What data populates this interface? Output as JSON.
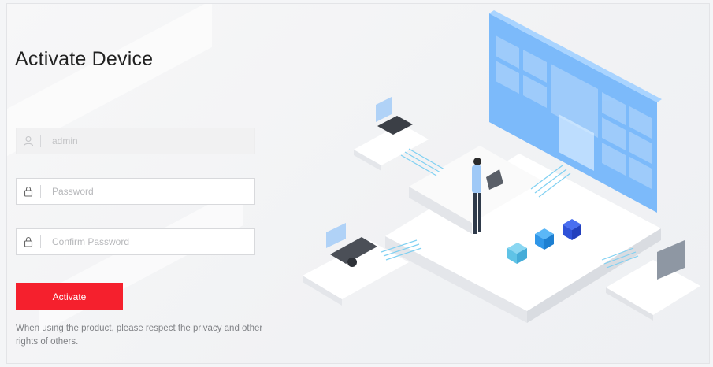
{
  "page": {
    "title": "Activate Device"
  },
  "form": {
    "username": {
      "value": "admin",
      "icon": "user-icon",
      "disabled": true
    },
    "password": {
      "placeholder": "Password",
      "icon": "lock-icon"
    },
    "confirm_password": {
      "placeholder": "Confirm Password",
      "icon": "lock-icon"
    },
    "activate_label": "Activate",
    "notice": "When using the product, please respect the privacy and other rights of others."
  },
  "colors": {
    "accent": "#f5202d",
    "illustration_blue": "#5aa7f5"
  }
}
